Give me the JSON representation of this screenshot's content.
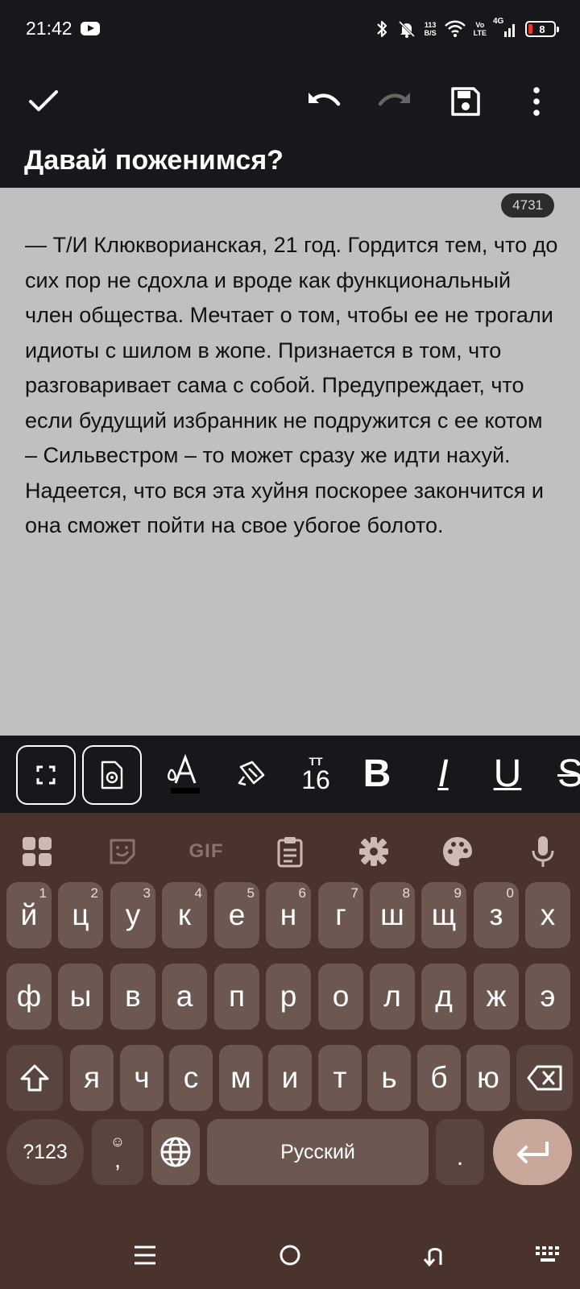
{
  "status_bar": {
    "time": "21:42",
    "net_speed_value": "113",
    "net_speed_unit": "B/S",
    "volte_top": "Vo",
    "volte_bottom": "LTE",
    "network": "4G",
    "battery": "8",
    "icons": [
      "youtube-icon",
      "bluetooth-icon",
      "bell-muted-icon",
      "wifi-icon",
      "signal-icon",
      "battery-icon"
    ]
  },
  "app_bar": {
    "title": "Давай поженимся?",
    "icons": [
      "check-icon",
      "undo-icon",
      "redo-icon",
      "save-icon",
      "more-vert-icon"
    ]
  },
  "editor": {
    "char_count": "4731",
    "body": "— Т/И Клюквори­анская, 21 год. Гордится тем, что до сих пор не сдохла и вроде как функциональный член общества. Мечтает о том, чтобы ее не трогали идиоты с шилом в жопе. Признается в том, что разговаривает сама с собой. Предупреждает, что если будущий избранник не подружится с ее котом – Сильвестром – то может сразу же идти нахуй. Надеется, что вся эта хуйня поскорее закончится и она сможет пойти на свое убогое болото."
  },
  "format_toolbar": {
    "font_size": "16",
    "font_size_caption": "TT",
    "bold": "B",
    "italic": "I",
    "underline": "U",
    "strike": "S",
    "icons": [
      "fullscreen-icon",
      "settings-doc-icon",
      "text-color-icon",
      "highlighter-icon",
      "font-size-icon",
      "bold-icon",
      "italic-icon",
      "underline-icon",
      "strikethrough-icon"
    ]
  },
  "keyboard": {
    "toolbar_gif": "GIF",
    "toolbar_icons": [
      "apps-grid-icon",
      "sticker-icon",
      "gif-icon",
      "clipboard-icon",
      "gear-icon",
      "palette-icon",
      "microphone-icon"
    ],
    "row1": [
      {
        "label": "й",
        "sup": "1"
      },
      {
        "label": "ц",
        "sup": "2"
      },
      {
        "label": "у",
        "sup": "3"
      },
      {
        "label": "к",
        "sup": "4"
      },
      {
        "label": "е",
        "sup": "5"
      },
      {
        "label": "н",
        "sup": "6"
      },
      {
        "label": "г",
        "sup": "7"
      },
      {
        "label": "ш",
        "sup": "8"
      },
      {
        "label": "щ",
        "sup": "9"
      },
      {
        "label": "з",
        "sup": "0"
      },
      {
        "label": "х",
        "sup": ""
      }
    ],
    "row2": [
      "ф",
      "ы",
      "в",
      "а",
      "п",
      "р",
      "о",
      "л",
      "д",
      "ж",
      "э"
    ],
    "row3": [
      "я",
      "ч",
      "с",
      "м",
      "и",
      "т",
      "ь",
      "б",
      "ю"
    ],
    "symbols_key": "?123",
    "comma_key": ",",
    "space_label": "Русский",
    "period_key": ".",
    "special_icons": [
      "shift-icon",
      "backspace-icon",
      "emoji-icon",
      "globe-icon",
      "enter-icon"
    ]
  },
  "nav_bar": {
    "icons": [
      "menu-icon",
      "home-icon",
      "back-icon",
      "keyboard-switch-icon"
    ]
  },
  "colors": {
    "app_bg": "#18181c",
    "editor_bg": "#c2bfc3",
    "keyboard_bg": "#4a332d",
    "key_bg": "#6d5751",
    "enter_bg": "#c9a79b"
  }
}
